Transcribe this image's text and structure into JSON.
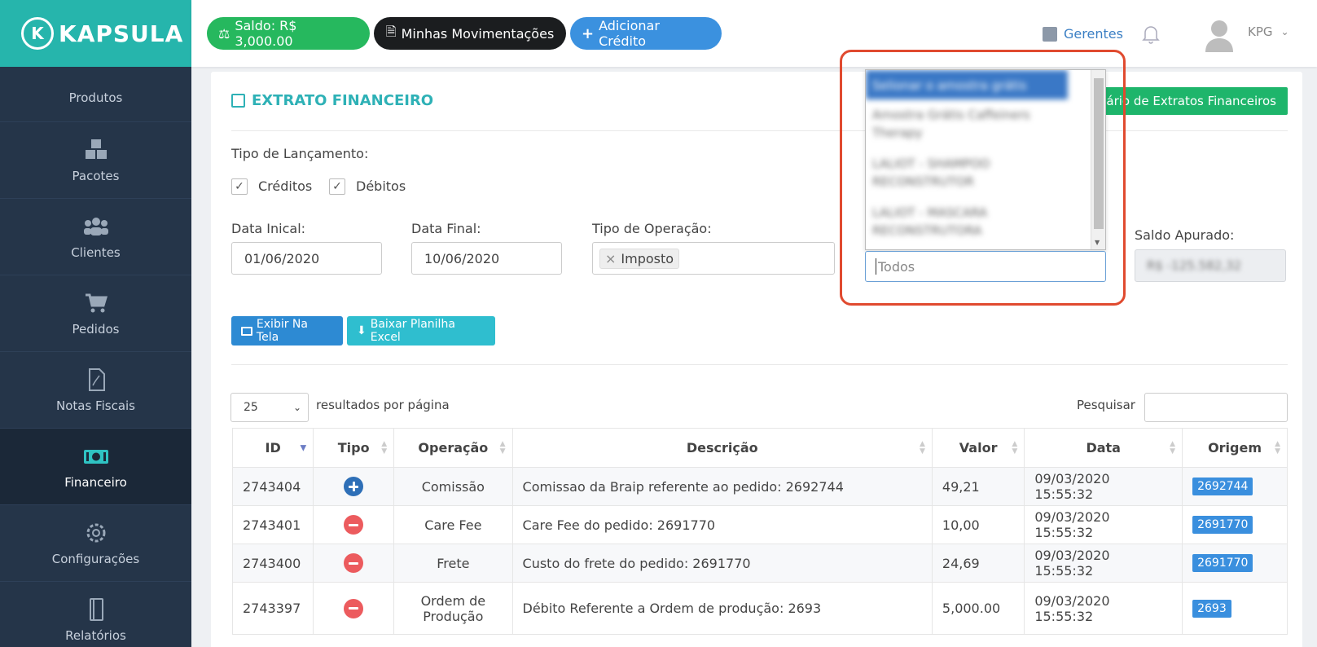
{
  "brand": {
    "name": "KAPSULA",
    "initial": "K"
  },
  "sidebar": {
    "items": [
      {
        "label": "Produtos",
        "icon": "box-icon"
      },
      {
        "label": "Pacotes",
        "icon": "cubes-icon"
      },
      {
        "label": "Clientes",
        "icon": "users-icon"
      },
      {
        "label": "Pedidos",
        "icon": "cart-icon"
      },
      {
        "label": "Notas Fiscais",
        "icon": "pdf-file-icon"
      },
      {
        "label": "Financeiro",
        "icon": "money-icon"
      },
      {
        "label": "Configurações",
        "icon": "gear-icon"
      },
      {
        "label": "Relatórios",
        "icon": "notebook-icon"
      }
    ]
  },
  "topbar": {
    "saldo": "Saldo: R$ 3,000.00",
    "movimentacoes": "Minhas Movimentações",
    "adicionar": "Adicionar Crédito",
    "gerentes": "Gerentes",
    "user": "KPG"
  },
  "panel": {
    "title": "EXTRATO FINANCEIRO",
    "calendar_button": "dário de Extratos Financeiros",
    "tipo_lancamento": "Tipo de Lançamento:",
    "creditos": "Créditos",
    "debitos": "Débitos",
    "data_inicial_label": "Data Inical:",
    "data_inicial": "01/06/2020",
    "data_final_label": "Data Final:",
    "data_final": "10/06/2020",
    "tipo_operacao_label": "Tipo de Operação:",
    "tipo_operacao_tag": "Imposto",
    "saldo_apurado_label": "Saldo Apurado:",
    "saldo_apurado_value": "R$ -125.582,32",
    "produto_placeholder": "Todos",
    "exibir": "Exibir Na Tela",
    "excel": "Baixar Planilha Excel",
    "page_size": "25",
    "per_page": "resultados por página",
    "search_label": "Pesquisar"
  },
  "dropdown": {
    "options": [
      "Selionar o amostra grátis",
      "Amostra Grátis Caffeiners Therapy",
      "LALIOT - SHAMPOO RECONSTRUTOR",
      "LALIOT - MASCARA RECONSTRUTORA"
    ]
  },
  "table": {
    "headers": [
      "ID",
      "Tipo",
      "Operação",
      "Descrição",
      "Valor",
      "Data",
      "Origem"
    ],
    "rows": [
      {
        "id": "2743404",
        "tipo": "credit",
        "operacao": "Comissão",
        "descricao": "Comissao da Braip referente ao pedido: 2692744",
        "valor": "49,21",
        "data": "09/03/2020 15:55:32",
        "origem": "2692744"
      },
      {
        "id": "2743401",
        "tipo": "debit",
        "operacao": "Care Fee",
        "descricao": "Care Fee do pedido: 2691770",
        "valor": "10,00",
        "data": "09/03/2020 15:55:32",
        "origem": "2691770"
      },
      {
        "id": "2743400",
        "tipo": "debit",
        "operacao": "Frete",
        "descricao": "Custo do frete do pedido: 2691770",
        "valor": "24,69",
        "data": "09/03/2020 15:55:32",
        "origem": "2691770"
      },
      {
        "id": "2743397",
        "tipo": "debit",
        "operacao": "Ordem de Produção",
        "descricao": "Débito Referente a Ordem de produção: 2693",
        "valor": "5,000.00",
        "data": "09/03/2020 15:55:32",
        "origem": "2693"
      }
    ]
  },
  "colors": {
    "brand": "#26b5ac",
    "sidebar": "#253549",
    "accent_red": "#e04a2f"
  }
}
